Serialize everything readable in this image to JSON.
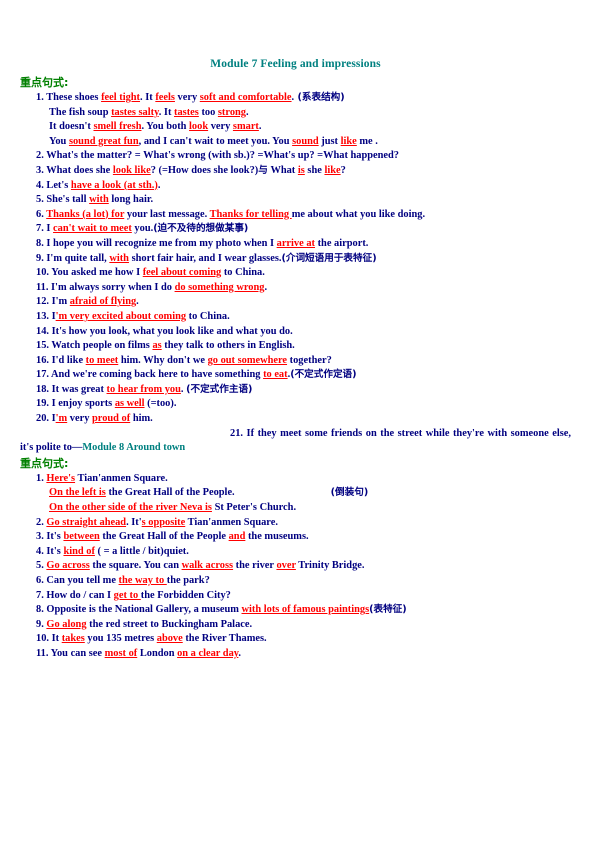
{
  "document": {
    "module7": {
      "title": "Module 7  Feeling and impressions",
      "section_label": "重点句式:",
      "items": [
        {
          "num": "1.",
          "parts": [
            {
              "t": "These shoes ",
              "s": "plain"
            },
            {
              "t": "feel tight",
              "s": "ru"
            },
            {
              "t": ".",
              "s": "plain"
            },
            {
              "t": "    It ",
              "s": "plain"
            },
            {
              "t": "feels",
              "s": "ru"
            },
            {
              "t": " very ",
              "s": "plain"
            },
            {
              "t": "soft and comfortable",
              "s": "ru"
            },
            {
              "t": ".",
              "s": "plain"
            },
            {
              "t": "   (系表结构)",
              "s": "cn"
            }
          ]
        },
        {
          "num": "",
          "parts": [
            {
              "t": "The fish soup ",
              "s": "plain"
            },
            {
              "t": "tastes salty",
              "s": "ru"
            },
            {
              "t": ". It ",
              "s": "plain"
            },
            {
              "t": "tastes",
              "s": "ru"
            },
            {
              "t": " too ",
              "s": "plain"
            },
            {
              "t": "strong",
              "s": "ru"
            },
            {
              "t": ".",
              "s": "plain"
            }
          ]
        },
        {
          "num": "",
          "parts": [
            {
              "t": "It doesn't ",
              "s": "plain"
            },
            {
              "t": "smell fresh",
              "s": "ru"
            },
            {
              "t": ".",
              "s": "plain"
            },
            {
              "t": "     You both ",
              "s": "plain"
            },
            {
              "t": "look",
              "s": "ru"
            },
            {
              "t": " very ",
              "s": "plain"
            },
            {
              "t": "smart",
              "s": "ru"
            },
            {
              "t": ".",
              "s": "plain"
            }
          ]
        },
        {
          "num": "",
          "parts": [
            {
              "t": "You ",
              "s": "plain"
            },
            {
              "t": "sound great fun",
              "s": "ru"
            },
            {
              "t": ", and I can't wait to meet you. You ",
              "s": "plain"
            },
            {
              "t": "sound",
              "s": "ru"
            },
            {
              "t": " just ",
              "s": "plain"
            },
            {
              "t": "like",
              "s": "ru"
            },
            {
              "t": " me .",
              "s": "plain"
            }
          ]
        },
        {
          "num": "2.",
          "parts": [
            {
              "t": "What's the matter? = What's wrong (with sb.)? =What's up? =What happened?",
              "s": "plain"
            }
          ]
        },
        {
          "num": "3.",
          "parts": [
            {
              "t": "What does she ",
              "s": "plain"
            },
            {
              "t": "look like",
              "s": "ru"
            },
            {
              "t": "? (=How does she look?)",
              "s": "plain"
            },
            {
              "t": "与",
              "s": "cn"
            },
            {
              "t": " What ",
              "s": "plain"
            },
            {
              "t": "is",
              "s": "ru"
            },
            {
              "t": " she ",
              "s": "plain"
            },
            {
              "t": "like",
              "s": "ru"
            },
            {
              "t": "?",
              "s": "plain"
            }
          ]
        },
        {
          "num": "4.",
          "parts": [
            {
              "t": "Let's ",
              "s": "plain"
            },
            {
              "t": "have a look (at sth.)",
              "s": "ru"
            },
            {
              "t": ".",
              "s": "plain"
            }
          ]
        },
        {
          "num": "5.",
          "parts": [
            {
              "t": "She's tall ",
              "s": "plain"
            },
            {
              "t": "with",
              "s": "ru"
            },
            {
              "t": " long hair.",
              "s": "plain"
            }
          ]
        },
        {
          "num": "6.",
          "parts": [
            {
              "t": "Thanks (a lot) for",
              "s": "ru"
            },
            {
              "t": " your last message. ",
              "s": "plain"
            },
            {
              "t": "Thanks for telling ",
              "s": "ru"
            },
            {
              "t": "me about what you like doing.",
              "s": "plain"
            }
          ]
        },
        {
          "num": "7.",
          "parts": [
            {
              "t": "I ",
              "s": "plain"
            },
            {
              "t": "can't wait to meet",
              "s": "ru"
            },
            {
              "t": " you.",
              "s": "plain"
            },
            {
              "t": "(迫不及待的想做某事)",
              "s": "cn"
            }
          ]
        },
        {
          "num": "8.",
          "parts": [
            {
              "t": "I hope you will recognize me from my photo when I ",
              "s": "plain"
            },
            {
              "t": "arrive at",
              "s": "ru"
            },
            {
              "t": " the airport.",
              "s": "plain"
            }
          ]
        },
        {
          "num": "9.",
          "parts": [
            {
              "t": "I'm quite tall, ",
              "s": "plain"
            },
            {
              "t": "with",
              "s": "ru"
            },
            {
              "t": " short fair hair, and I wear glasses.",
              "s": "plain"
            },
            {
              "t": "(介词短语用于表特征)",
              "s": "cn"
            }
          ]
        },
        {
          "num": "10.",
          "parts": [
            {
              "t": "You asked me how I ",
              "s": "plain"
            },
            {
              "t": "feel about coming",
              "s": "ru"
            },
            {
              "t": " to China.",
              "s": "plain"
            }
          ]
        },
        {
          "num": "11.",
          "parts": [
            {
              "t": "I'm always sorry when I do ",
              "s": "plain"
            },
            {
              "t": "do something wrong",
              "s": "ru"
            },
            {
              "t": ".",
              "s": "plain"
            }
          ]
        },
        {
          "num": "12.",
          "parts": [
            {
              "t": "I'm ",
              "s": "plain"
            },
            {
              "t": "afraid of flying",
              "s": "ru"
            },
            {
              "t": ".",
              "s": "plain"
            }
          ]
        },
        {
          "num": "13.",
          "parts": [
            {
              "t": "I",
              "s": "plain"
            },
            {
              "t": "'m very excited about coming",
              "s": "ru"
            },
            {
              "t": " to China.",
              "s": "plain"
            }
          ]
        },
        {
          "num": "14.",
          "parts": [
            {
              "t": "It's how you look, what you look like and what you do.",
              "s": "plain"
            }
          ]
        },
        {
          "num": "15.",
          "parts": [
            {
              "t": "Watch people on films ",
              "s": "plain"
            },
            {
              "t": "as",
              "s": "ru"
            },
            {
              "t": " they talk to others in English.",
              "s": "plain"
            }
          ]
        },
        {
          "num": "16.",
          "parts": [
            {
              "t": "I'd like ",
              "s": "plain"
            },
            {
              "t": "to meet",
              "s": "ru"
            },
            {
              "t": " him. Why don't we ",
              "s": "plain"
            },
            {
              "t": "go out somewhere",
              "s": "ru"
            },
            {
              "t": " together?",
              "s": "plain"
            }
          ]
        },
        {
          "num": "17.",
          "parts": [
            {
              "t": "And we're coming back here to have something ",
              "s": "plain"
            },
            {
              "t": "to eat",
              "s": "ru"
            },
            {
              "t": ".",
              "s": "plain"
            },
            {
              "t": "(不定式作定语)",
              "s": "cn"
            }
          ]
        },
        {
          "num": "18.",
          "parts": [
            {
              "t": "It was great ",
              "s": "plain"
            },
            {
              "t": "to hear from you",
              "s": "ru"
            },
            {
              "t": ". ",
              "s": "plain"
            },
            {
              "t": "(不定式作主语)",
              "s": "cn"
            }
          ]
        },
        {
          "num": "19.",
          "parts": [
            {
              "t": "I enjoy sports ",
              "s": "plain"
            },
            {
              "t": "as well",
              "s": "ru"
            },
            {
              "t": " (=too).",
              "s": "plain"
            }
          ]
        },
        {
          "num": "20.",
          "parts": [
            {
              "t": "I",
              "s": "plain"
            },
            {
              "t": "'m",
              "s": "ru"
            },
            {
              "t": " very ",
              "s": "plain"
            },
            {
              "t": "proud of",
              "s": "ru"
            },
            {
              "t": " him.",
              "s": "plain"
            }
          ]
        }
      ],
      "item21": {
        "num": "21.",
        "text": "If they meet some friends on the street while they're with someone else, it's polite to—"
      }
    },
    "module8": {
      "title_inline": "Module 8    Around town",
      "section_label": "重点句式:",
      "items": [
        {
          "num": "1.",
          "parts": [
            {
              "t": "Here's",
              "s": "ru"
            },
            {
              "t": " Tian'anmen Square.",
              "s": "plain"
            }
          ]
        },
        {
          "num": "",
          "parts": [
            {
              "t": "On the left is",
              "s": "ru"
            },
            {
              "t": " the Great Hall of the People.",
              "s": "plain"
            },
            {
              "t": "SPACER",
              "s": "spacer"
            },
            {
              "t": "(倒装句)",
              "s": "cn"
            }
          ]
        },
        {
          "num": "",
          "parts": [
            {
              "t": "On the other side of the river Neva is",
              "s": "ru"
            },
            {
              "t": " St Peter's Church.",
              "s": "plain"
            }
          ]
        },
        {
          "num": "2.",
          "parts": [
            {
              "t": "Go straight ahead",
              "s": "ru"
            },
            {
              "t": ". It'",
              "s": "plain"
            },
            {
              "t": "s opposite",
              "s": "ru"
            },
            {
              "t": " Tian'anmen Square.",
              "s": "plain"
            }
          ]
        },
        {
          "num": "3.",
          "parts": [
            {
              "t": "It's ",
              "s": "plain"
            },
            {
              "t": "between",
              "s": "ru"
            },
            {
              "t": " the Great Hall of the People ",
              "s": "plain"
            },
            {
              "t": "and",
              "s": "ru"
            },
            {
              "t": " the museums.",
              "s": "plain"
            }
          ]
        },
        {
          "num": "4.",
          "parts": [
            {
              "t": "It's ",
              "s": "plain"
            },
            {
              "t": "kind of",
              "s": "ru"
            },
            {
              "t": " ( = a little / bit)quiet.",
              "s": "plain"
            }
          ]
        },
        {
          "num": "5.",
          "parts": [
            {
              "t": "Go across",
              "s": "ru"
            },
            {
              "t": " the square.    You can ",
              "s": "plain"
            },
            {
              "t": "walk across",
              "s": "ru"
            },
            {
              "t": " the river ",
              "s": "plain"
            },
            {
              "t": "over",
              "s": "ru"
            },
            {
              "t": " Trinity Bridge.",
              "s": "plain"
            }
          ]
        },
        {
          "num": "6.",
          "parts": [
            {
              "t": "Can you tell me ",
              "s": "plain"
            },
            {
              "t": "the way to ",
              "s": "ru"
            },
            {
              "t": "the park?",
              "s": "plain"
            }
          ]
        },
        {
          "num": "7.",
          "parts": [
            {
              "t": "How do / can I ",
              "s": "plain"
            },
            {
              "t": "get to ",
              "s": "ru"
            },
            {
              "t": "the Forbidden City?",
              "s": "plain"
            }
          ]
        },
        {
          "num": "8.",
          "parts": [
            {
              "t": "Opposite is the National Gallery, a museum ",
              "s": "plain"
            },
            {
              "t": "with lots of famous paintings",
              "s": "ru"
            },
            {
              "t": "(表特征)",
              "s": "cn"
            }
          ]
        },
        {
          "num": "9.",
          "parts": [
            {
              "t": "Go along",
              "s": "ru"
            },
            {
              "t": " the red street to Buckingham Palace.",
              "s": "plain"
            }
          ]
        },
        {
          "num": "10.",
          "parts": [
            {
              "t": "It ",
              "s": "plain"
            },
            {
              "t": "takes",
              "s": "ru"
            },
            {
              "t": " you 135 metres ",
              "s": "plain"
            },
            {
              "t": "above",
              "s": "ru"
            },
            {
              "t": " the River Thames.",
              "s": "plain"
            }
          ]
        },
        {
          "num": "11.",
          "parts": [
            {
              "t": "You can see ",
              "s": "plain"
            },
            {
              "t": "most of",
              "s": "ru"
            },
            {
              "t": " London ",
              "s": "plain"
            },
            {
              "t": "on a clear day",
              "s": "ru"
            },
            {
              "t": ".",
              "s": "plain"
            }
          ]
        }
      ]
    },
    "colors": {
      "title": "#008080",
      "section_label": "#008000",
      "body_text": "#000080",
      "highlight": "#FF0000"
    }
  }
}
